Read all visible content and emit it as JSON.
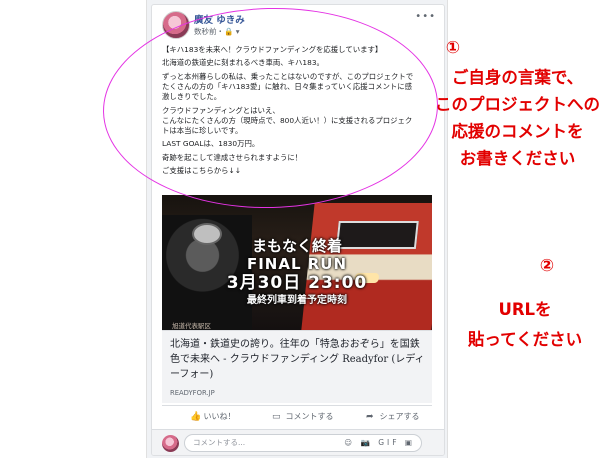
{
  "post": {
    "user_name": "廣友 ゆきみ",
    "meta": "数秒前・🔒 ▾",
    "more": "•••",
    "body_lines": [
      "【キハ183を未来へ！クラウドファンディングを応援しています】",
      "北海道の鉄道史に刻まれるべき車両、キハ183。",
      "ずっと本州暮らしの私は、乗ったことはないのですが、このプロジェクトで\nたくさんの方の「キハ183愛」に触れ、日々集まっていく応援コメントに感\n激しきりでした。",
      "クラウドファンディングとはいえ、\nこんなにたくさんの方（現時点で、800人近い！）に支援されるプロジェク\nトは本当に珍しいです。",
      "LAST GOALは、1830万円。",
      "奇跡を起こして達成させられますように！",
      "ご支援はこちらから↓↓"
    ]
  },
  "preview": {
    "overlay_line1": "まもなく終着",
    "overlay_line2": "FINAL RUN",
    "overlay_line3": "3月30日 23:00",
    "overlay_line4": "最終列車到着予定時刻",
    "strip_label": "旭道代表駅区",
    "link_title": "北海道・鉄道史の誇り。往年の「特急おおぞら」を国鉄色で未来へ - クラウドファンディング Readyfor (レディーフォー)",
    "link_domain": "READYFOR.JP"
  },
  "actions": {
    "like_label": "いいね！",
    "comment_label": "コメントする",
    "share_label": "シェアする"
  },
  "comment": {
    "placeholder": "コメントする...",
    "icons": "☺ 📷 GIF ▣"
  },
  "annotations": {
    "marker1": "①",
    "text1_lines": [
      "ご自身の言葉で、",
      "このプロジェクトへの",
      "応援のコメントを",
      "お書きください"
    ],
    "marker2": "②",
    "text2_lines": [
      "URLを",
      "貼ってください"
    ]
  },
  "colors": {
    "ellipse": "#e433e4",
    "annotation_text": "#e20000",
    "link_blue": "#385898"
  }
}
